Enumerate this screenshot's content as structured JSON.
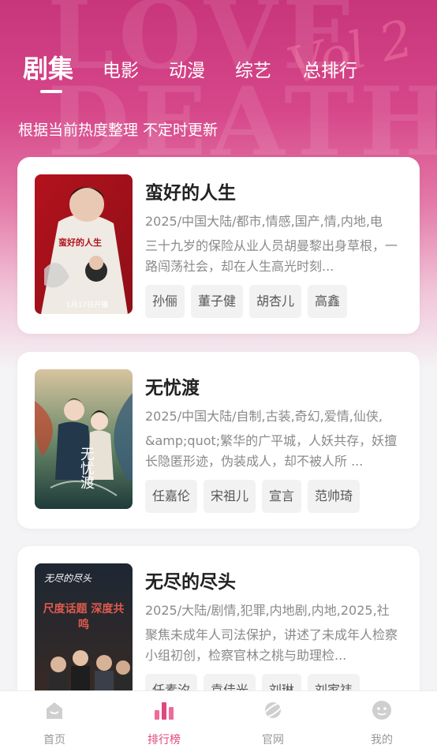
{
  "tabs": [
    {
      "label": "剧集",
      "active": true
    },
    {
      "label": "电影",
      "active": false
    },
    {
      "label": "动漫",
      "active": false
    },
    {
      "label": "综艺",
      "active": false
    },
    {
      "label": "总排行",
      "active": false
    }
  ],
  "subtitle": "根据当前热度整理 不定时更新",
  "accent_color": "#e0467e",
  "hero_color": "#d6478a",
  "cards": [
    {
      "title": "蛮好的人生",
      "meta": "2025/中国大陆/都市,情感,国产,情,内地,电",
      "desc": "三十九岁的保险从业人员胡曼黎出身草根，一路闯荡社会，却在人生高光时刻...",
      "tags": [
        "孙俪",
        "董子健",
        "胡杏儿",
        "高鑫"
      ],
      "poster_title": "蛮好的人生",
      "poster_caption": "1月17日开播"
    },
    {
      "title": "无忧渡",
      "meta": "2025/中国大陆/自制,古装,奇幻,爱情,仙侠,",
      "desc": "&amp;quot;繁华的广平城，人妖共存，妖擅长隐匿形迹，伪装成人，却不被人所 ...",
      "tags": [
        "任嘉伦",
        "宋祖儿",
        "宣言",
        "范帅琦"
      ],
      "poster_title": "无忧渡"
    },
    {
      "title": "无尽的尽头",
      "meta": "2025/大陆/剧情,犯罪,内地剧,内地,2025,社",
      "desc": "聚焦未成年人司法保护，讲述了未成年人检察小组初创，检察官林之桃与助理检...",
      "tags": [
        "任素汐",
        "袁佳光",
        "刘琳",
        "刘家祎"
      ],
      "poster_title": "无尽的尽头",
      "poster_caption": "尺度话题 深度共鸣"
    }
  ],
  "nav": [
    {
      "label": "首页",
      "icon": "home-icon",
      "active": false
    },
    {
      "label": "排行榜",
      "icon": "ranking-icon",
      "active": true
    },
    {
      "label": "官网",
      "icon": "planet-icon",
      "active": false
    },
    {
      "label": "我的",
      "icon": "profile-icon",
      "active": false
    }
  ]
}
